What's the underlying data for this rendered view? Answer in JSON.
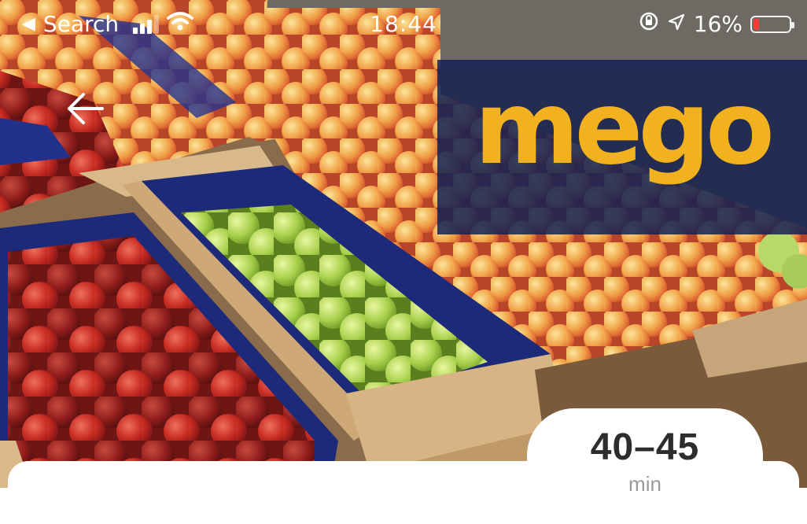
{
  "status_bar": {
    "back_label": "Search",
    "time": "18:44",
    "battery_percent": "16%",
    "battery_level": 0.16,
    "signal_bars": 3,
    "icons": [
      "signal-icon",
      "wifi-icon",
      "orientation-lock-icon",
      "location-icon",
      "battery-icon"
    ]
  },
  "header": {
    "back_icon": "arrow-left-icon",
    "brand_logo": "mego",
    "hero_image": "fruit-market-apples"
  },
  "delivery": {
    "time_range": "40–45",
    "unit": "min"
  },
  "colors": {
    "banner": "#142254",
    "logo": "#f2b21f",
    "battery_low": "#ff3b30"
  }
}
